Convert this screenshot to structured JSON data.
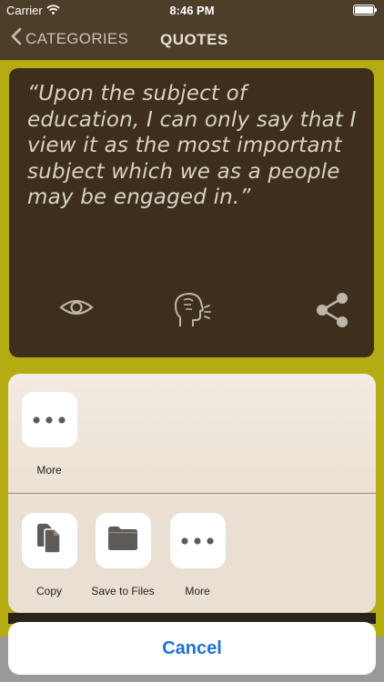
{
  "status_bar": {
    "carrier": "Carrier",
    "time": "8:46 PM"
  },
  "nav": {
    "back_label": "CATEGORIES",
    "title": "QUOTES"
  },
  "quote": {
    "text": "“Upon the subject of education, I can only say that I view it as the most important subject which we as a people may be engaged in.”",
    "icons": [
      "eye-icon",
      "speak-head-icon",
      "share-icon"
    ]
  },
  "share_sheet": {
    "top_row": [
      {
        "label": "More",
        "icon": "more-icon"
      }
    ],
    "actions": [
      {
        "label": "Copy",
        "icon": "copy-icon"
      },
      {
        "label": "Save to Files",
        "icon": "folder-icon"
      },
      {
        "label": "More",
        "icon": "more-icon"
      }
    ],
    "cancel_label": "Cancel"
  },
  "colors": {
    "background": "#b5ab12",
    "nav_bar": "#4d3e2a",
    "card": "#3d2f1c",
    "accent_blue": "#1f73d1"
  }
}
